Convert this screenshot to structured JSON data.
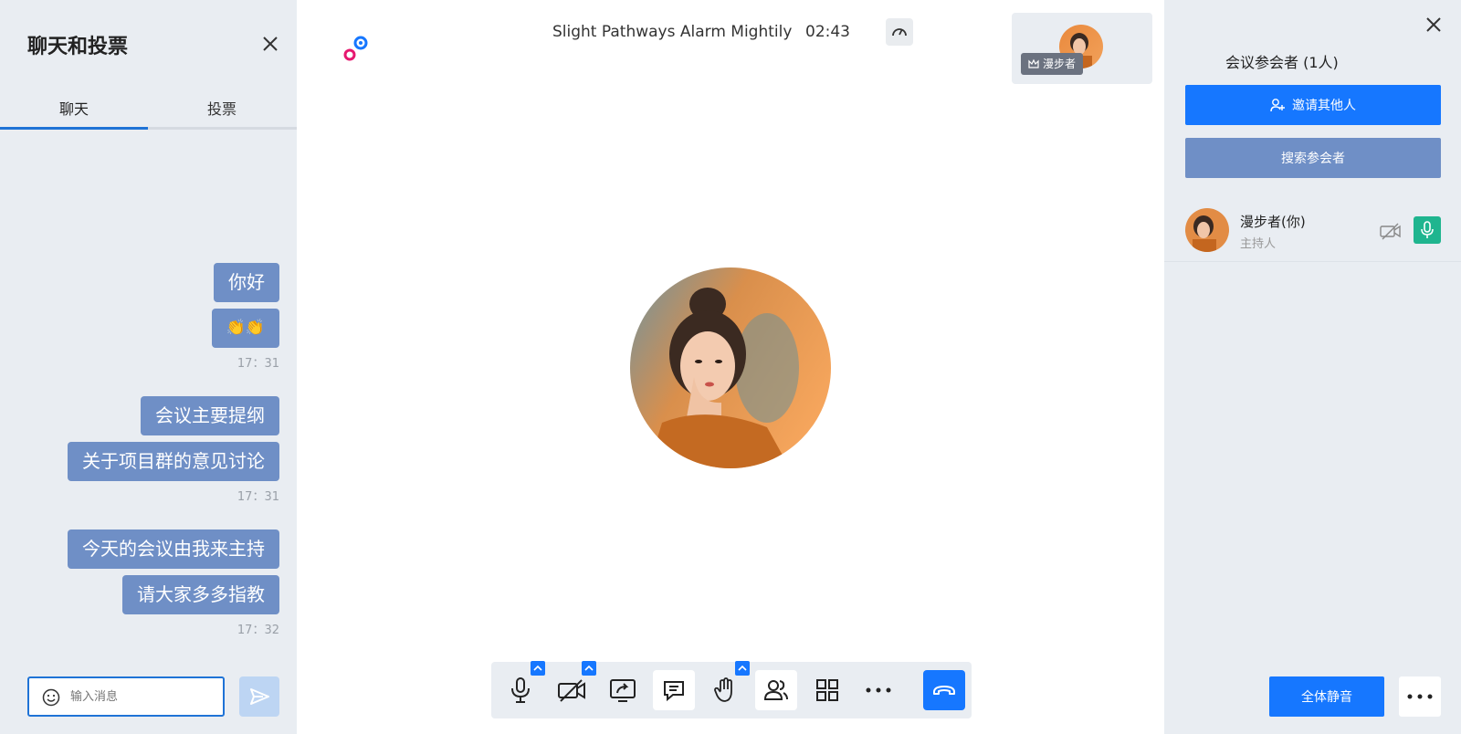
{
  "chat": {
    "title": "聊天和投票",
    "tabs": [
      {
        "label": "聊天",
        "active": true
      },
      {
        "label": "投票",
        "active": false
      }
    ],
    "groups": [
      {
        "messages": [
          "你好",
          "👏👏"
        ],
        "time": "17：31"
      },
      {
        "messages": [
          "会议主要提纲",
          "关于项目群的意见讨论"
        ],
        "time": "17：31"
      },
      {
        "messages": [
          "今天的会议由我来主持",
          "请大家多多指教"
        ],
        "time": "17：32"
      }
    ],
    "input_placeholder": "输入消息"
  },
  "meeting": {
    "title": "Slight Pathways Alarm Mightily",
    "timer": "02:43",
    "self_tile_name": "漫步者"
  },
  "participants": {
    "title": "会议参会者 (1人)",
    "invite_label": "邀请其他人",
    "search_label": "搜索参会者",
    "list": [
      {
        "name": "漫步者(你)",
        "role": "主持人"
      }
    ],
    "mute_all_label": "全体静音"
  },
  "colors": {
    "accent": "#1677ff",
    "bubble": "#6f8fc6",
    "panel_bg": "#e9edf2",
    "mic_on": "#1fb58f"
  }
}
